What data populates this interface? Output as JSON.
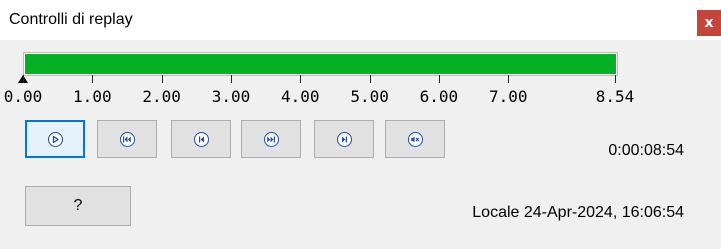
{
  "window": {
    "title": "Controlli di replay",
    "close_label": "x"
  },
  "progress": {
    "fraction": 1.0,
    "color": "#06b025"
  },
  "timeline": {
    "ticks": [
      "0.00",
      "1.00",
      "2.00",
      "3.00",
      "4.00",
      "5.00",
      "6.00",
      "7.00",
      "8.54"
    ],
    "tick_values": [
      0,
      1,
      2,
      3,
      4,
      5,
      6,
      7,
      8.54
    ],
    "max": 8.54,
    "marker_value": 0
  },
  "controls": {
    "buttons": [
      {
        "id": "play",
        "icon": "play-icon",
        "active": true
      },
      {
        "id": "rewind-to-start",
        "icon": "rewind-to-start-icon",
        "active": false
      },
      {
        "id": "step-back",
        "icon": "step-back-icon",
        "active": false
      },
      {
        "id": "fast-forward",
        "icon": "fast-forward-icon",
        "active": false
      },
      {
        "id": "step-forward",
        "icon": "step-forward-icon",
        "active": false
      },
      {
        "id": "mute",
        "icon": "mute-icon",
        "active": false
      }
    ],
    "elapsed_time": "0:00:08:54"
  },
  "footer": {
    "help_label": "?",
    "local_time": "Locale 24-Apr-2024, 16:06:54"
  },
  "colors": {
    "accent": "#0078d7",
    "icon": "#1f4e9e",
    "close": "#c6453a"
  }
}
